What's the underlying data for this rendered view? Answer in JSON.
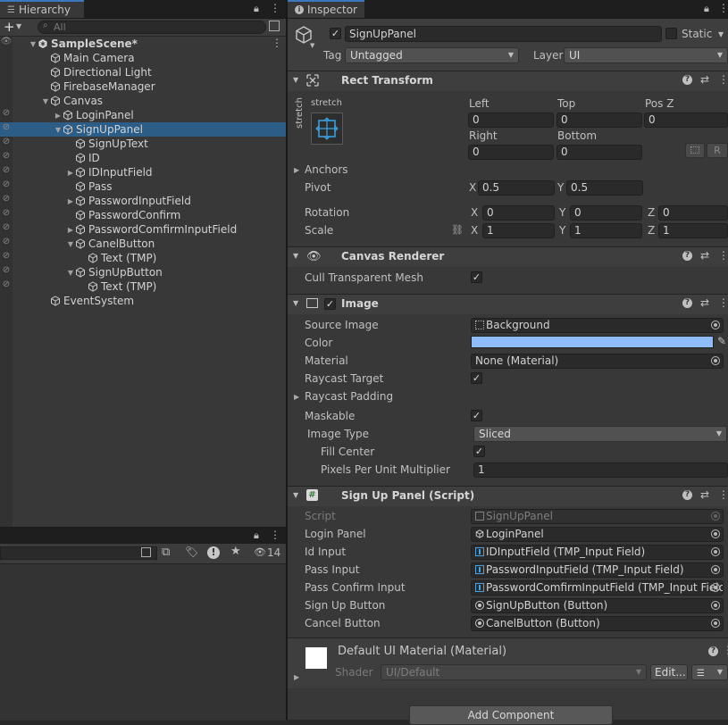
{
  "hierarchy": {
    "tab_label": "Hierarchy",
    "search_placeholder": "All",
    "rows": [
      {
        "label": "SampleScene*",
        "depth": 0,
        "expanded": true,
        "scene": true
      },
      {
        "label": "Main Camera",
        "depth": 1
      },
      {
        "label": "Directional Light",
        "depth": 1
      },
      {
        "label": "FirebaseManager",
        "depth": 1
      },
      {
        "label": "Canvas",
        "depth": 1,
        "expanded": true
      },
      {
        "label": "LoginPanel",
        "depth": 2,
        "collapsed": true
      },
      {
        "label": "SignUpPanel",
        "depth": 2,
        "expanded": true,
        "selected": true
      },
      {
        "label": "SignUpText",
        "depth": 3
      },
      {
        "label": "ID",
        "depth": 3
      },
      {
        "label": "IDInputField",
        "depth": 3,
        "collapsed": true
      },
      {
        "label": "Pass",
        "depth": 3
      },
      {
        "label": "PasswordInputField",
        "depth": 3,
        "collapsed": true
      },
      {
        "label": "PasswordConfirm",
        "depth": 3
      },
      {
        "label": "PasswordComfirmInputField",
        "depth": 3,
        "collapsed": true
      },
      {
        "label": "CanelButton",
        "depth": 3,
        "expanded": true
      },
      {
        "label": "Text (TMP)",
        "depth": 4
      },
      {
        "label": "SignUpButton",
        "depth": 3,
        "expanded": true
      },
      {
        "label": "Text (TMP)",
        "depth": 4
      },
      {
        "label": "EventSystem",
        "depth": 1
      }
    ]
  },
  "bottom_panel": {
    "count": "14"
  },
  "inspector": {
    "tab_label": "Inspector",
    "object_name": "SignUpPanel",
    "static_label": "Static",
    "tag_label": "Tag",
    "tag_value": "Untagged",
    "layer_label": "Layer",
    "layer_value": "UI",
    "rect_transform": {
      "title": "Rect Transform",
      "anchor_preset_label": "stretch",
      "anchor_preset_side": "stretch",
      "left_label": "Left",
      "left": "0",
      "top_label": "Top",
      "top": "0",
      "posz_label": "Pos Z",
      "posz": "0",
      "right_label": "Right",
      "right": "0",
      "bottom_label": "Bottom",
      "bottom": "0",
      "r_button": "R",
      "anchors_label": "Anchors",
      "pivot_label": "Pivot",
      "pivot_x": "0.5",
      "pivot_y": "0.5",
      "rotation_label": "Rotation",
      "rot_x": "0",
      "rot_y": "0",
      "rot_z": "0",
      "scale_label": "Scale",
      "scale_x": "1",
      "scale_y": "1",
      "scale_z": "1",
      "x": "X",
      "y": "Y",
      "z": "Z"
    },
    "canvas_renderer": {
      "title": "Canvas Renderer",
      "cull_label": "Cull Transparent Mesh"
    },
    "image": {
      "title": "Image",
      "source_image_label": "Source Image",
      "source_image": "Background",
      "color_label": "Color",
      "color": "#8ebcfd",
      "material_label": "Material",
      "material": "None (Material)",
      "raycast_target_label": "Raycast Target",
      "raycast_padding_label": "Raycast Padding",
      "maskable_label": "Maskable",
      "image_type_label": "Image Type",
      "image_type": "Sliced",
      "fill_center_label": "Fill Center",
      "ppu_label": "Pixels Per Unit Multiplier",
      "ppu": "1"
    },
    "script": {
      "title": "Sign Up Panel (Script)",
      "script_label": "Script",
      "script_value": "SignUpPanel",
      "fields": [
        {
          "label": "Login Panel",
          "value": "LoginPanel",
          "icon": "cube"
        },
        {
          "label": "Id Input",
          "value": "IDInputField (TMP_Input Field)",
          "icon": "inputfield"
        },
        {
          "label": "Pass Input",
          "value": "PasswordInputField (TMP_Input Field)",
          "icon": "inputfield"
        },
        {
          "label": "Pass Confirm Input",
          "value": "PasswordComfirmInputField (TMP_Input Field)",
          "icon": "inputfield"
        },
        {
          "label": "Sign Up Button",
          "value": "SignUpButton (Button)",
          "icon": "button"
        },
        {
          "label": "Cancel Button",
          "value": "CanelButton (Button)",
          "icon": "button"
        }
      ]
    },
    "material": {
      "title": "Default UI Material (Material)",
      "shader_label": "Shader",
      "shader_value": "UI/Default",
      "edit_label": "Edit..."
    },
    "add_component_label": "Add Component"
  },
  "colors": {
    "accent": "#3a79bb",
    "selection": "#2c5d87",
    "panel": "#383838"
  }
}
